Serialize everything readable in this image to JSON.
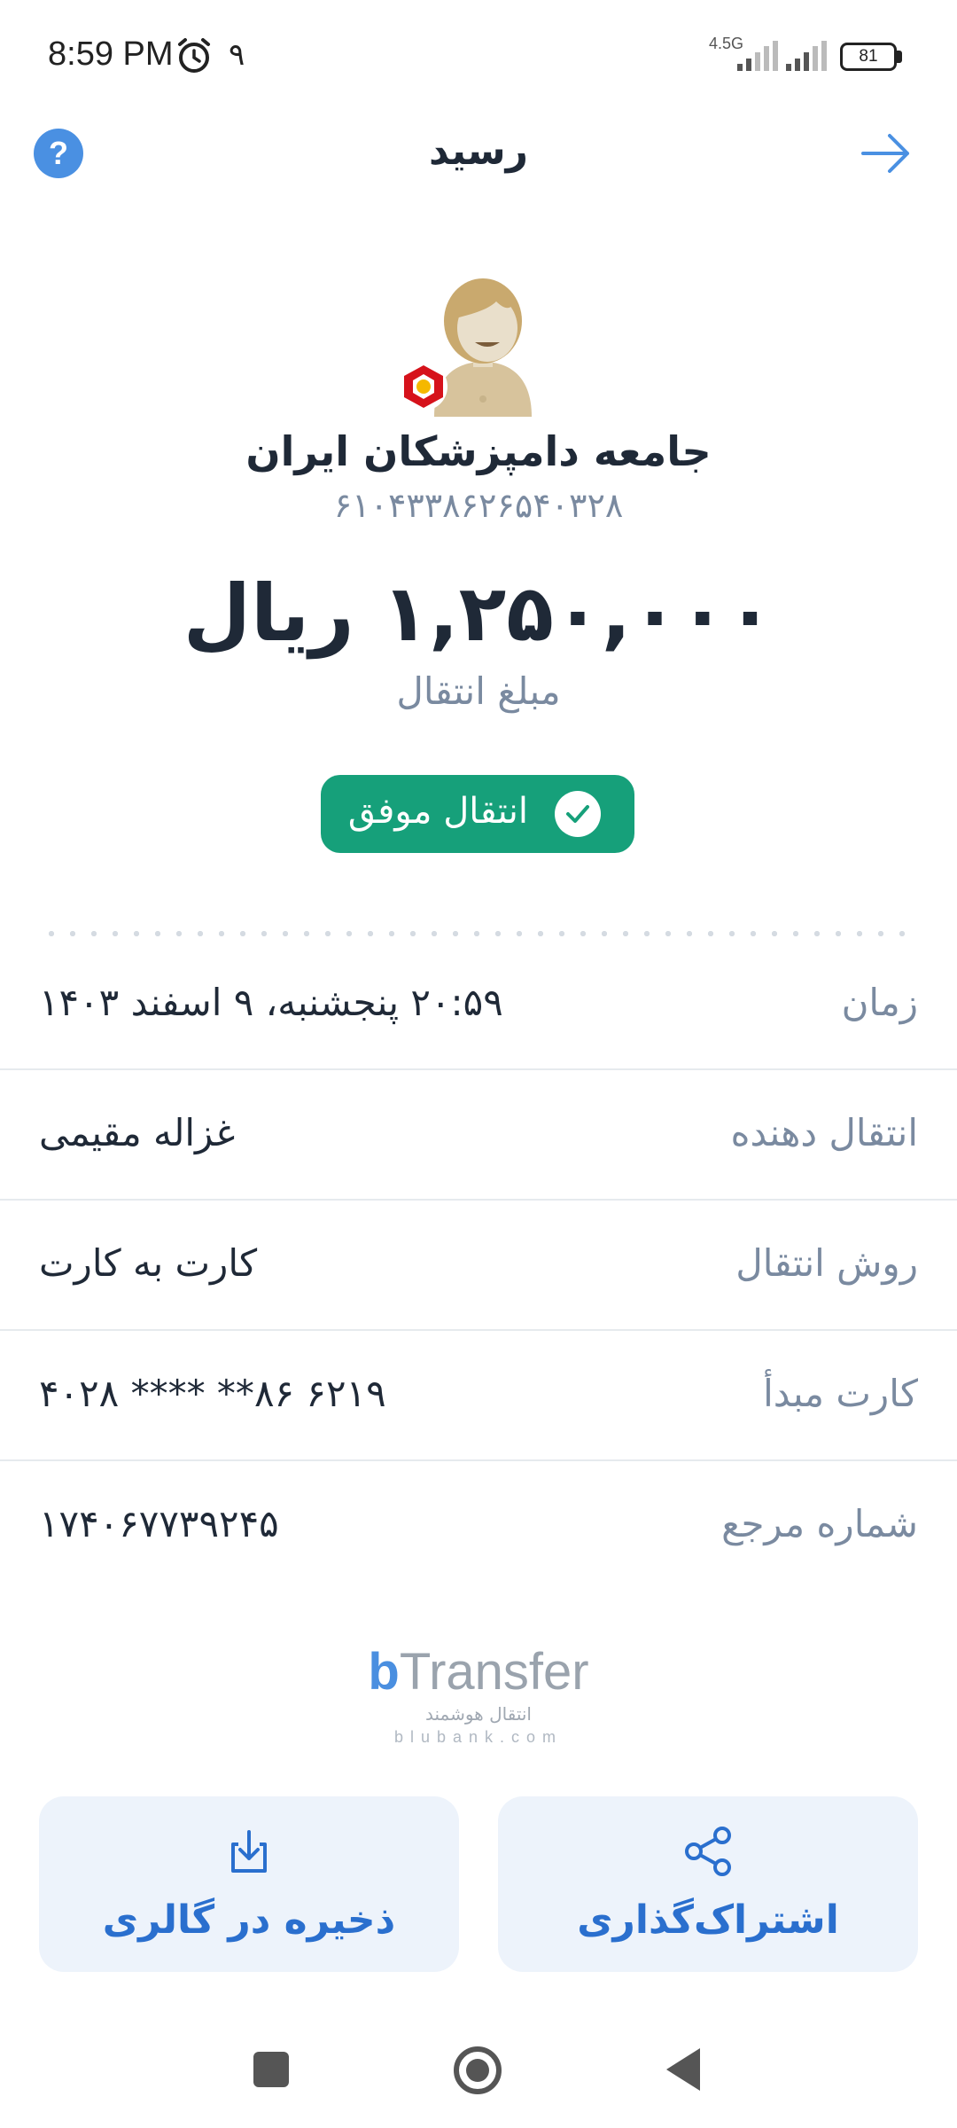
{
  "status_bar": {
    "time": "8:59 PM",
    "extra": "۹",
    "network": "4.5G",
    "battery": "81",
    "icons": [
      "alarm-icon",
      "signal-icon",
      "signal-icon",
      "battery-icon"
    ]
  },
  "header": {
    "title": "رسید",
    "help_icon": "?",
    "back_icon": "arrow-right-icon"
  },
  "receiver": {
    "name": "جامعه دامپزشکان ایران",
    "card_number": "۶۱۰۴۳۳۸۶۲۶۵۴۰۳۲۸",
    "avatar_icon": "avatar-icon",
    "bank_icon": "bank-logo-icon"
  },
  "transfer": {
    "amount": "۱,۲۵۰,۰۰۰ ریال",
    "amount_label": "مبلغ انتقال",
    "status": "انتقال موفق"
  },
  "details": [
    {
      "label": "زمان",
      "value": "۲۰:۵۹ پنجشنبه، ۹ اسفند ۱۴۰۳"
    },
    {
      "label": "انتقال دهنده",
      "value": "غزاله مقیمی"
    },
    {
      "label": "روش انتقال",
      "value": "کارت به کارت"
    },
    {
      "label": "کارت مبدأ",
      "value": "۶۲۱۹  ۸۶**  ****  ۴۰۲۸"
    },
    {
      "label": "شماره مرجع",
      "value": "۱۷۴۰۶۷۷۳۹۲۴۵"
    }
  ],
  "brand": {
    "logo_b": "b",
    "logo_text": "Transfer",
    "subtitle": "انتقال هوشمند",
    "url": "blubank.com"
  },
  "actions": {
    "share_label": "اشتراک‌گذاری",
    "save_label": "ذخیره در گالری"
  },
  "colors": {
    "accent": "#4a90e2",
    "success": "#16a07a",
    "action_bg": "#edf3fb",
    "action_text": "#2a6fce"
  }
}
